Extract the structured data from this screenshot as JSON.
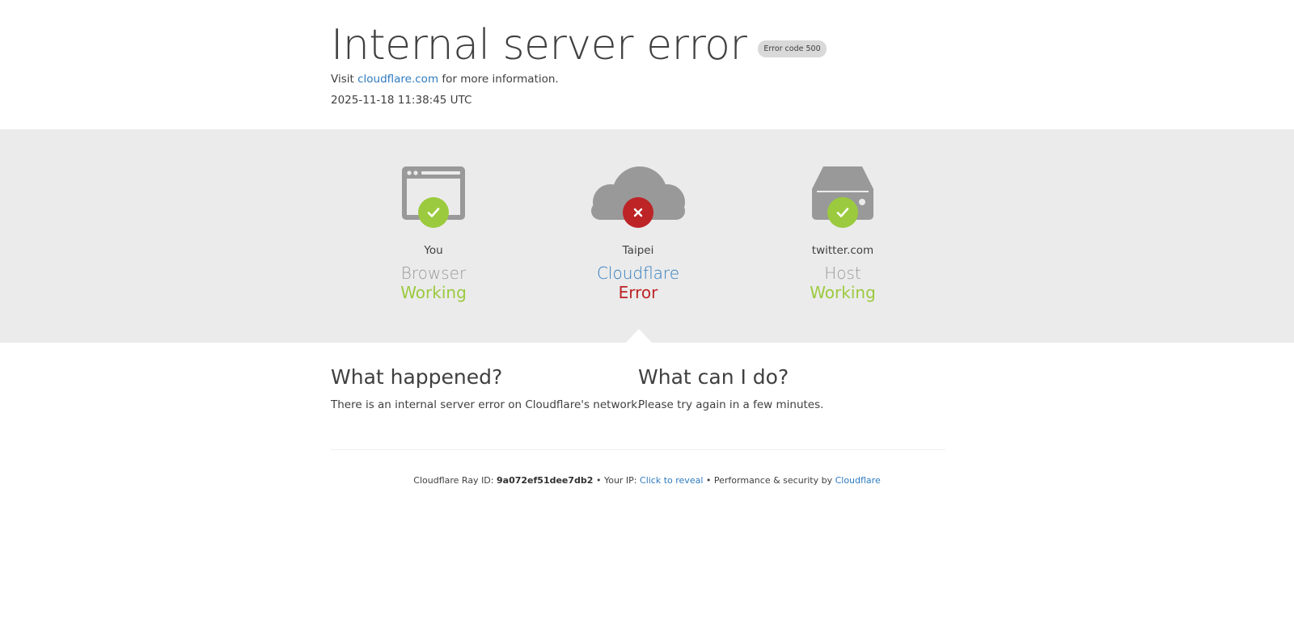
{
  "header": {
    "title": "Internal server error",
    "error_badge": "Error code 500",
    "visit_prefix": "Visit",
    "visit_link": "cloudflare.com",
    "visit_suffix": "for more information.",
    "timestamp": "2025-11-18 11:38:45 UTC"
  },
  "status": {
    "you": {
      "location": "You",
      "role": "Browser",
      "state": "Working",
      "icon": "browser-icon"
    },
    "cloudflare": {
      "location": "Taipei",
      "role": "Cloudflare",
      "state": "Error",
      "icon": "cloud-icon"
    },
    "host": {
      "location": "twitter.com",
      "role": "Host",
      "state": "Working",
      "icon": "server-icon"
    }
  },
  "info": {
    "what_happened_title": "What happened?",
    "what_happened_text": "There is an internal server error on Cloudflare's network.",
    "what_can_i_do_title": "What can I do?",
    "what_can_i_do_text": "Please try again in a few minutes."
  },
  "footer": {
    "ray_label": "Cloudflare Ray ID:",
    "ray_id": "9a072ef51dee7db2",
    "sep1": "•",
    "ip_label": "Your IP:",
    "ip_link": "Click to reveal",
    "sep2": "•",
    "perf_label": "Performance & security by",
    "cf_link": "Cloudflare"
  },
  "colors": {
    "working": "#9bca3e",
    "error": "#bd2426",
    "link": "#2f7bbf",
    "icon_gray": "#999999",
    "band": "#ebebeb"
  }
}
